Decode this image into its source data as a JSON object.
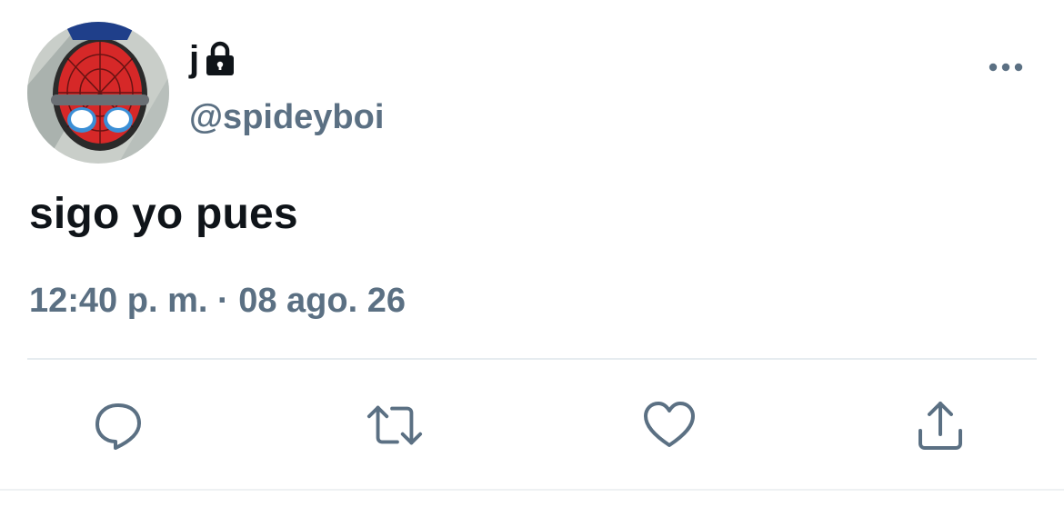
{
  "user": {
    "display_name": "j",
    "handle": "@spideyboi",
    "protected_icon": "lock-icon",
    "avatar": "spider-man-mask-avatar"
  },
  "tweet": {
    "text": "sigo yo pues",
    "time": "12:40 p. m.",
    "separator": "·",
    "date": "08 ago. 26"
  },
  "actions": {
    "reply_icon": "reply-icon",
    "retweet_icon": "retweet-icon",
    "like_icon": "heart-icon",
    "share_icon": "share-icon",
    "more_icon": "more-icon"
  },
  "colors": {
    "text_primary": "#0f1419",
    "text_secondary": "#5b7083",
    "divider": "#e6ecf0"
  }
}
